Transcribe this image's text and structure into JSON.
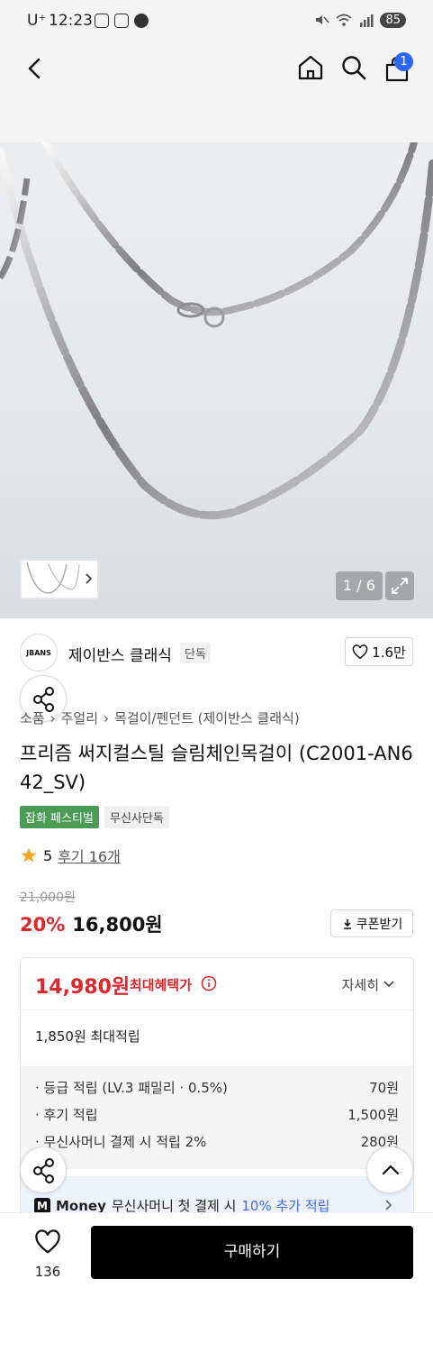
{
  "status_bar": {
    "carrier": "U⁺",
    "time": "12:23",
    "battery": "85"
  },
  "header": {
    "cart_count": "1"
  },
  "gallery": {
    "counter": "1 / 6"
  },
  "brand": {
    "name": "제이반스 클래식",
    "logo_text": "JBANS",
    "exclusive_tag": "단독",
    "likes": "1.6만"
  },
  "breadcrumb": [
    "소품",
    "주얼리",
    "목걸이/펜던트 (제이반스 클래식)"
  ],
  "product": {
    "title": "프리즘 써지컬스틸 슬림체인목걸이 (C2001-AN642_SV)"
  },
  "badges": {
    "festival": "잡화 페스티벌",
    "exclusive": "무신사단독"
  },
  "rating": {
    "score": "5",
    "review_link": "후기 16개"
  },
  "price": {
    "original": "21,000원",
    "discount": "20%",
    "sale": "16,800원",
    "coupon": "쿠폰받기"
  },
  "benefit": {
    "max_price": "14,980원",
    "max_label": "최대혜택가",
    "detail": "자세히",
    "points_total": "1,850원 최대적립",
    "points": [
      {
        "label": "· 등급 적립 (LV.3 패밀리 · 0.5%)",
        "value": "70원"
      },
      {
        "label": "· 후기 적립",
        "value": "1,500원"
      },
      {
        "label": "· 무신사머니 결제 시 적립 2%",
        "value": "280원"
      }
    ],
    "money_brand": "Money",
    "money_text": "무신사머니 첫 결제 시",
    "money_accent": "10% 추가 적립"
  },
  "bottom": {
    "fav_count": "136",
    "buy_label": "구매하기"
  },
  "colors": {
    "sale_red": "#e0252b",
    "badge_green": "#4b9a56",
    "accent_blue": "#3b6df0",
    "cart_badge": "#2a67f5"
  }
}
